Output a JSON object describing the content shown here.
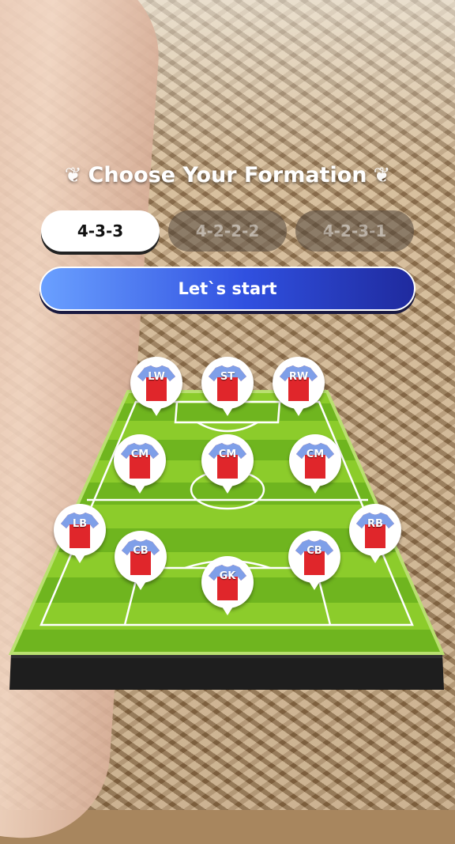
{
  "title": "Choose Your Formation",
  "formations": [
    {
      "label": "4-3-3",
      "active": true
    },
    {
      "label": "4-2-2-2",
      "active": false
    },
    {
      "label": "4-2-3-1",
      "active": false
    }
  ],
  "start_label": "Let`s start",
  "colors": {
    "shirt": "#e0262b",
    "sleeve": "#7f9fe8",
    "pitch_light": "#8ccc2b",
    "pitch_dark": "#6fb51f",
    "start_from": "#6aa0ff",
    "start_to": "#1f2a9e"
  },
  "players": [
    {
      "position": "LW"
    },
    {
      "position": "ST"
    },
    {
      "position": "RW"
    },
    {
      "position": "CM"
    },
    {
      "position": "CM"
    },
    {
      "position": "CM"
    },
    {
      "position": "LB"
    },
    {
      "position": "RB"
    },
    {
      "position": "CB"
    },
    {
      "position": "CB"
    },
    {
      "position": "GK"
    }
  ]
}
